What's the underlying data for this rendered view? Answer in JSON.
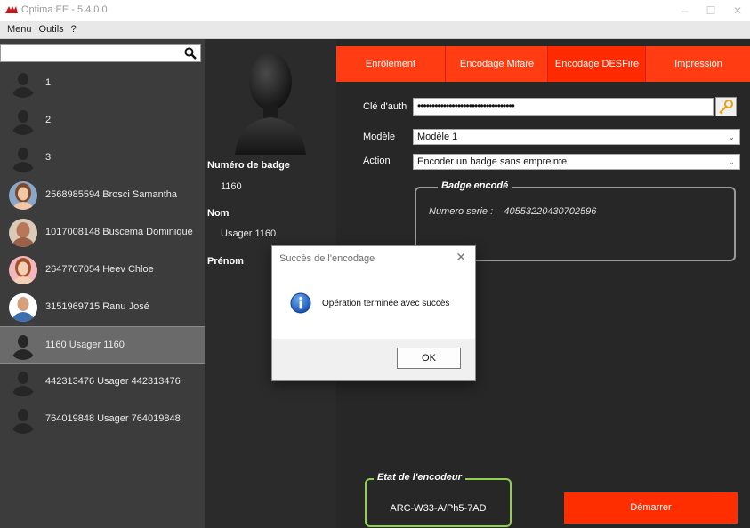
{
  "window": {
    "title": "Optima EE - 5.4.0.0",
    "minimize": "–",
    "maximize": "☐",
    "close": "✕"
  },
  "menu": {
    "items": [
      "Menu",
      "Outils",
      "?"
    ]
  },
  "search": {
    "value": "",
    "placeholder": ""
  },
  "users": [
    {
      "label": "1",
      "avatar": "silhouette"
    },
    {
      "label": "2",
      "avatar": "silhouette"
    },
    {
      "label": "3",
      "avatar": "silhouette"
    },
    {
      "label": "2568985594  Brosci  Samantha",
      "avatar": "photo"
    },
    {
      "label": "1017008148  Buscema  Dominique",
      "avatar": "photo"
    },
    {
      "label": "2647707054  Heev  Chloe",
      "avatar": "photo"
    },
    {
      "label": "3151969715  Ranu  José",
      "avatar": "photo"
    },
    {
      "label": "1160  Usager  1160",
      "avatar": "silhouette",
      "selected": true
    },
    {
      "label": "442313476  Usager  442313476",
      "avatar": "silhouette"
    },
    {
      "label": "764019848  Usager  764019848",
      "avatar": "silhouette"
    }
  ],
  "details": {
    "badge_label": "Numéro de badge",
    "badge_value": "1160",
    "nom_label": "Nom",
    "nom_value": "Usager  1160",
    "prenom_label": "Prénom",
    "prenom_value": ""
  },
  "tabs": [
    {
      "label": "Enrôlement"
    },
    {
      "label": "Encodage Mifare"
    },
    {
      "label": "Encodage DESFire",
      "active": true
    },
    {
      "label": "Impression"
    }
  ],
  "form": {
    "auth_label": "Clé d'auth",
    "auth_value": "••••••••••••••••••••••••••••••••••",
    "model_label": "Modèle",
    "model_value": "Modèle 1",
    "action_label": "Action",
    "action_value": "Encoder un badge sans empreinte"
  },
  "badge_panel": {
    "title": "Badge encodé",
    "serial_label": "Numero serie :",
    "serial_value": "40553220430702596"
  },
  "encoder_panel": {
    "title": "Etat de l'encodeur",
    "value": "ARC-W33-A/Ph5-7AD"
  },
  "start_button": "Démarrer",
  "dialog": {
    "title": "Succès de l'encodage",
    "message": "Opération terminée avec succès",
    "ok": "OK"
  },
  "colors": {
    "accent": "#ff3c12",
    "encoder_border": "#8fd14f",
    "selected_row": "#6a6a6a"
  }
}
